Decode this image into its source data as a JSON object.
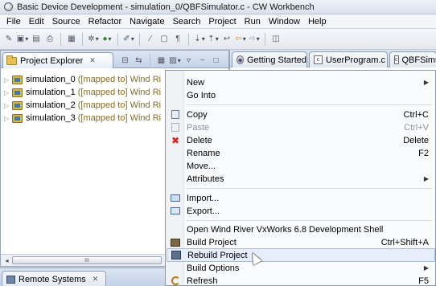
{
  "window": {
    "title": "Basic Device Development - simulation_0/QBFSimulator.c - CW Workbench"
  },
  "menubar": [
    "File",
    "Edit",
    "Source",
    "Refactor",
    "Navigate",
    "Search",
    "Project",
    "Run",
    "Window",
    "Help"
  ],
  "project_explorer": {
    "tab_label": "Project Explorer",
    "projects": [
      {
        "name": "simulation_0",
        "decoration": "([mapped to] Wind Ri"
      },
      {
        "name": "simulation_1",
        "decoration": "([mapped to] Wind Ri"
      },
      {
        "name": "simulation_2",
        "decoration": "([mapped to] Wind Ri"
      },
      {
        "name": "simulation_3",
        "decoration": "([mapped to] Wind Ri"
      }
    ],
    "scroll_thumb_glyph": "III"
  },
  "remote_systems": {
    "tab_label": "Remote Systems"
  },
  "editor_tabs": [
    "Getting Started",
    "UserProgram.c",
    "QBFSimu"
  ],
  "context_menu": {
    "items": [
      {
        "label": "New",
        "submenu": true
      },
      {
        "label": "Go Into"
      },
      {
        "label": "Copy",
        "shortcut": "Ctrl+C",
        "icon": "copy-icon"
      },
      {
        "label": "Paste",
        "shortcut": "Ctrl+V",
        "icon": "paste-icon",
        "disabled": true
      },
      {
        "label": "Delete",
        "shortcut": "Delete",
        "icon": "delete-icon"
      },
      {
        "label": "Rename",
        "shortcut": "F2"
      },
      {
        "label": "Move..."
      },
      {
        "label": "Attributes",
        "submenu": true
      },
      {
        "label": "Import...",
        "icon": "import-icon"
      },
      {
        "label": "Export...",
        "icon": "export-icon"
      },
      {
        "label": "Open Wind River VxWorks 6.8 Development Shell"
      },
      {
        "label": "Build Project",
        "shortcut": "Ctrl+Shift+A",
        "icon": "build-icon"
      },
      {
        "label": "Rebuild Project",
        "icon": "rebuild-icon",
        "highlighted": true
      },
      {
        "label": "Build Options",
        "submenu": true
      },
      {
        "label": "Refresh",
        "shortcut": "F5",
        "icon": "refresh-icon"
      }
    ]
  },
  "colors": {
    "highlight_bg": "#e6eefb",
    "highlight_border": "#a9bde0",
    "tab_bar": "#c4d3e7",
    "decoration": "#8a6d1e"
  }
}
